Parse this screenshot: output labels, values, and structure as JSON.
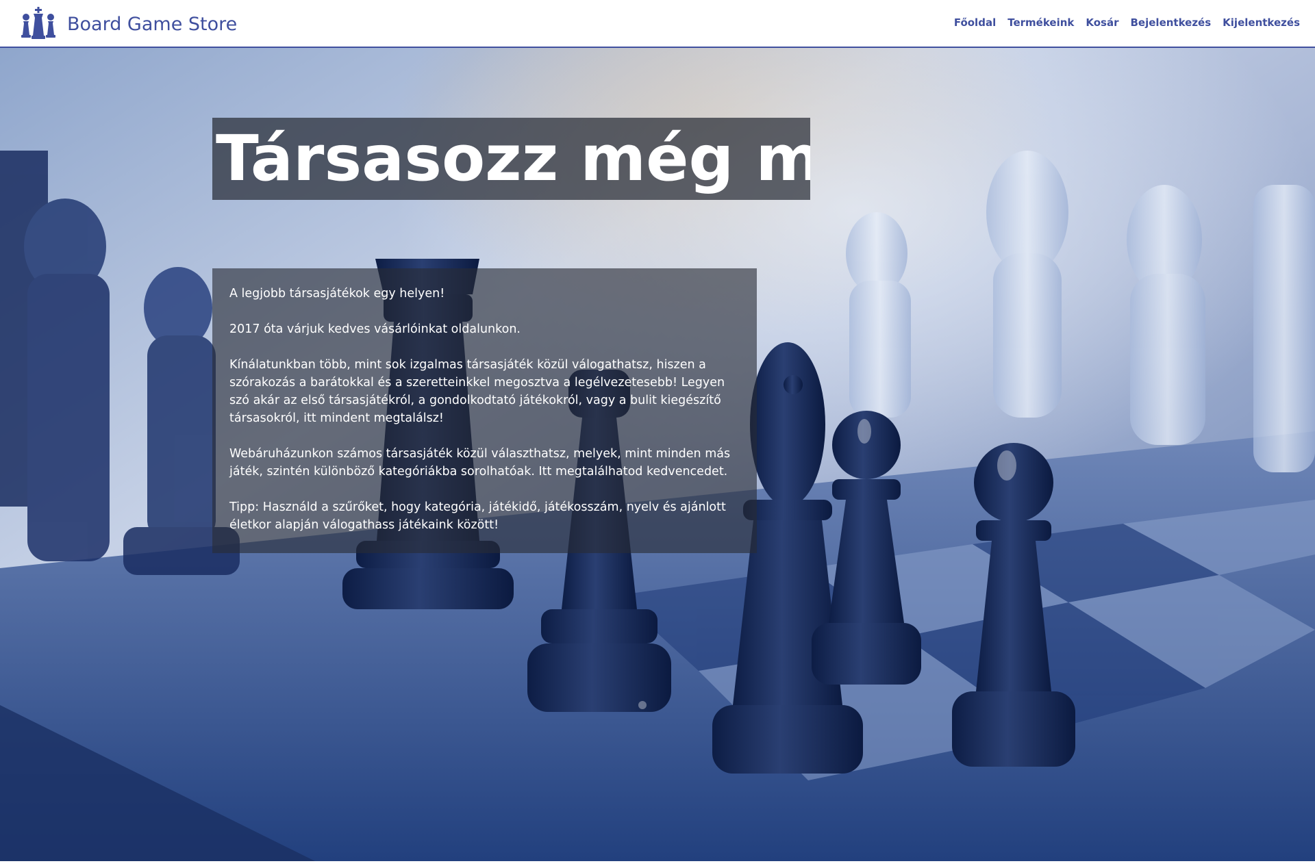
{
  "header": {
    "brand_name": "Board Game Store",
    "logo_icon": "chess-pieces-icon",
    "nav": [
      {
        "label": "Főoldal"
      },
      {
        "label": "Termékeink"
      },
      {
        "label": "Kosár"
      },
      {
        "label": "Bejelentkezés"
      },
      {
        "label": "Kijelentkezés"
      }
    ]
  },
  "hero": {
    "title": "Társasozz még ma!",
    "background_image": "chess-board-photo",
    "paragraphs": [
      "A legjobb társasjátékok egy helyen!",
      "2017 óta várjuk kedves vásárlóinkat oldalunkon.",
      "Kínálatunkban több, mint sok izgalmas társasjáték közül válogathatsz, hiszen a szórakozás a barátokkal és a szeretteinkkel megosztva a legélvezetesebb! Legyen szó akár az első társasjátékról, a gondolkodtató játékokról, vagy a bulit kiegészítő társasokról, itt mindent megtalálsz!",
      "Webáruházunkon számos társasjáték közül választhatsz, melyek, mint minden más játék, szintén különböző kategóriákba sorolhatóak. Itt megtalálhatod kedvencedet.",
      "Tipp: Használd a szűrőket, hogy kategória, játékidő, játékosszám, nyelv és ajánlott életkor alapján válogathass játékaink között!"
    ]
  },
  "colors": {
    "accent": "#3f4f9e",
    "overlay": "#282c36"
  }
}
